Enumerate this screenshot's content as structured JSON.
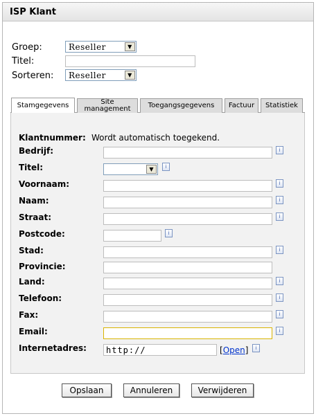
{
  "window": {
    "title": "ISP Klant"
  },
  "filters": {
    "group_label": "Groep:",
    "group_value": "Reseller",
    "title_label": "Titel:",
    "title_value": "",
    "sort_label": "Sorteren:",
    "sort_value": "Reseller"
  },
  "tabs": [
    {
      "label": "Stamgegevens"
    },
    {
      "label": "Site management"
    },
    {
      "label": "Toegangsgegevens"
    },
    {
      "label": "Factuur"
    },
    {
      "label": "Statistiek"
    }
  ],
  "form": {
    "klantnummer_label": "Klantnummer:",
    "klantnummer_value": "Wordt automatisch toegekend.",
    "fields": [
      {
        "label": "Bedrijf:",
        "value": ""
      },
      {
        "label": "Titel:",
        "value": ""
      },
      {
        "label": "Voornaam:",
        "value": ""
      },
      {
        "label": "Naam:",
        "value": ""
      },
      {
        "label": "Straat:",
        "value": ""
      },
      {
        "label": "Postcode:",
        "value": ""
      },
      {
        "label": "Stad:",
        "value": ""
      },
      {
        "label": "Provincie:",
        "value": ""
      },
      {
        "label": "Land:",
        "value": ""
      },
      {
        "label": "Telefoon:",
        "value": ""
      },
      {
        "label": "Fax:",
        "value": ""
      },
      {
        "label": "Email:",
        "value": ""
      },
      {
        "label": "Internetadres:",
        "value": "http://"
      }
    ],
    "open_link_label": "Open"
  },
  "buttons": {
    "save": "Opslaan",
    "cancel": "Annuleren",
    "delete": "Verwijderen"
  },
  "colors": {
    "focus_border": "#d9b400",
    "link": "#0033cc",
    "panel_bg": "#f2f2f2"
  }
}
